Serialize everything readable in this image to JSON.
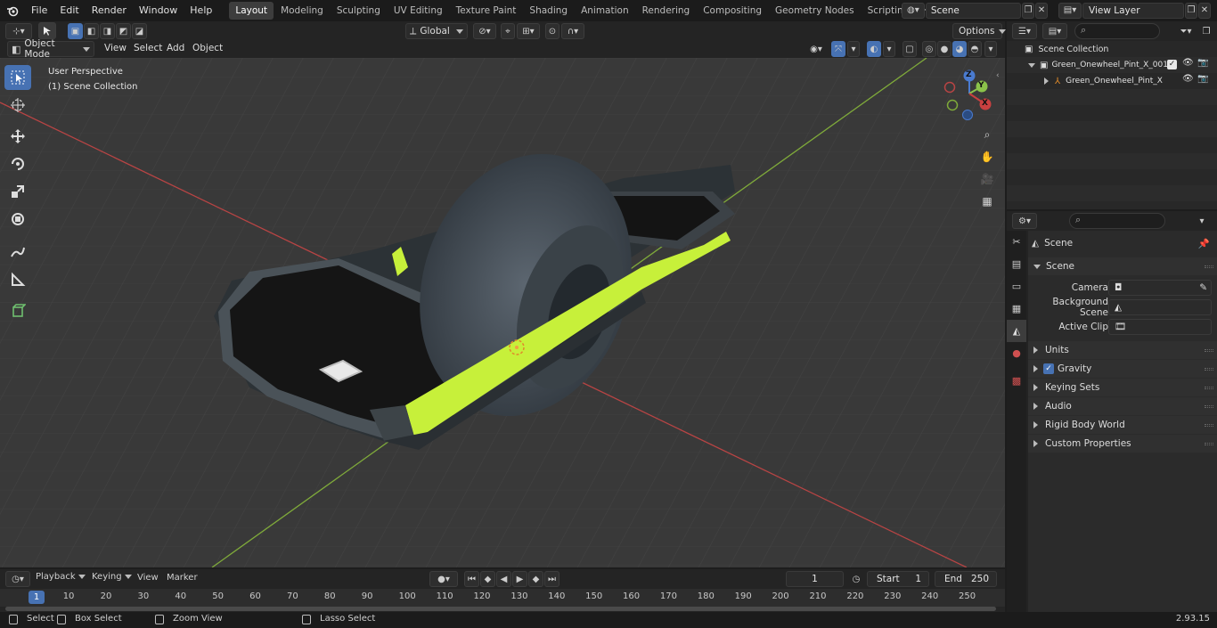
{
  "topbar": {
    "menus": [
      "File",
      "Edit",
      "Render",
      "Window",
      "Help"
    ],
    "workspaces": [
      "Layout",
      "Modeling",
      "Sculpting",
      "UV Editing",
      "Texture Paint",
      "Shading",
      "Animation",
      "Rendering",
      "Compositing",
      "Geometry Nodes",
      "Scripting"
    ],
    "active_workspace": "Layout",
    "add_tab": "+",
    "scene_name": "Scene",
    "view_layer": "View Layer"
  },
  "viewport_header": {
    "transform_orientation": "Global",
    "options_label": "Options"
  },
  "viewport_header2": {
    "mode": "Object Mode",
    "menus": [
      "View",
      "Select",
      "Add",
      "Object"
    ]
  },
  "viewport": {
    "perspective_label": "User Perspective",
    "collection_label": "(1) Scene Collection",
    "gizmo": {
      "z": "Z",
      "y": "Y",
      "x": "X"
    },
    "colors": {
      "x_axis": "#c84040",
      "y_axis": "#8bc34a",
      "z_axis": "#4a7bd0",
      "board_accent": "#c7f03a"
    }
  },
  "outliner": {
    "root": "Scene Collection",
    "items": [
      {
        "label": "Green_Onewheel_Pint_X_001",
        "icon": "collection-icon"
      },
      {
        "label": "Green_Onewheel_Pint_X",
        "icon": "empty-axes-icon"
      }
    ]
  },
  "properties": {
    "context": "Scene",
    "panel_title": "Scene",
    "fields": [
      {
        "label": "Camera",
        "icon": "camera-icon"
      },
      {
        "label": "Background Scene",
        "icon": "scene-icon"
      },
      {
        "label": "Active Clip",
        "icon": "clip-icon"
      }
    ],
    "collapsed_panels": [
      "Units",
      "Gravity",
      "Keying Sets",
      "Audio",
      "Rigid Body World",
      "Custom Properties"
    ],
    "gravity_checked": true
  },
  "timeline": {
    "menus": [
      "Playback",
      "Keying",
      "View",
      "Marker"
    ],
    "current_frame": "1",
    "start_label": "Start",
    "start_value": "1",
    "end_label": "End",
    "end_value": "250",
    "ruler_ticks": [
      "1",
      "10",
      "20",
      "30",
      "40",
      "50",
      "60",
      "70",
      "80",
      "90",
      "100",
      "110",
      "120",
      "130",
      "140",
      "150",
      "160",
      "170",
      "180",
      "190",
      "200",
      "210",
      "220",
      "230",
      "240",
      "250"
    ]
  },
  "statusbar": {
    "select": "Select",
    "box_select": "Box Select",
    "zoom_view": "Zoom View",
    "lasso_select": "Lasso Select",
    "version": "2.93.15"
  }
}
